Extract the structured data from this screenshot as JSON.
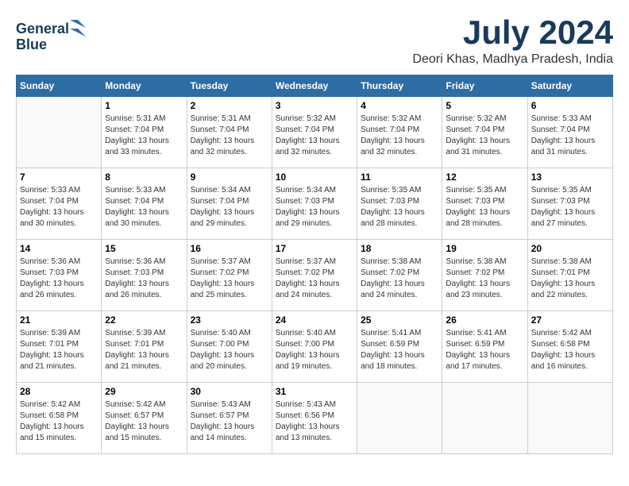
{
  "header": {
    "logo_line1": "General",
    "logo_line2": "Blue",
    "month_year": "July 2024",
    "location": "Deori Khas, Madhya Pradesh, India"
  },
  "days_of_week": [
    "Sunday",
    "Monday",
    "Tuesday",
    "Wednesday",
    "Thursday",
    "Friday",
    "Saturday"
  ],
  "weeks": [
    [
      {
        "day": "",
        "info": ""
      },
      {
        "day": "1",
        "info": "Sunrise: 5:31 AM\nSunset: 7:04 PM\nDaylight: 13 hours\nand 33 minutes."
      },
      {
        "day": "2",
        "info": "Sunrise: 5:31 AM\nSunset: 7:04 PM\nDaylight: 13 hours\nand 32 minutes."
      },
      {
        "day": "3",
        "info": "Sunrise: 5:32 AM\nSunset: 7:04 PM\nDaylight: 13 hours\nand 32 minutes."
      },
      {
        "day": "4",
        "info": "Sunrise: 5:32 AM\nSunset: 7:04 PM\nDaylight: 13 hours\nand 32 minutes."
      },
      {
        "day": "5",
        "info": "Sunrise: 5:32 AM\nSunset: 7:04 PM\nDaylight: 13 hours\nand 31 minutes."
      },
      {
        "day": "6",
        "info": "Sunrise: 5:33 AM\nSunset: 7:04 PM\nDaylight: 13 hours\nand 31 minutes."
      }
    ],
    [
      {
        "day": "7",
        "info": "Sunrise: 5:33 AM\nSunset: 7:04 PM\nDaylight: 13 hours\nand 30 minutes."
      },
      {
        "day": "8",
        "info": "Sunrise: 5:33 AM\nSunset: 7:04 PM\nDaylight: 13 hours\nand 30 minutes."
      },
      {
        "day": "9",
        "info": "Sunrise: 5:34 AM\nSunset: 7:04 PM\nDaylight: 13 hours\nand 29 minutes."
      },
      {
        "day": "10",
        "info": "Sunrise: 5:34 AM\nSunset: 7:03 PM\nDaylight: 13 hours\nand 29 minutes."
      },
      {
        "day": "11",
        "info": "Sunrise: 5:35 AM\nSunset: 7:03 PM\nDaylight: 13 hours\nand 28 minutes."
      },
      {
        "day": "12",
        "info": "Sunrise: 5:35 AM\nSunset: 7:03 PM\nDaylight: 13 hours\nand 28 minutes."
      },
      {
        "day": "13",
        "info": "Sunrise: 5:35 AM\nSunset: 7:03 PM\nDaylight: 13 hours\nand 27 minutes."
      }
    ],
    [
      {
        "day": "14",
        "info": "Sunrise: 5:36 AM\nSunset: 7:03 PM\nDaylight: 13 hours\nand 26 minutes."
      },
      {
        "day": "15",
        "info": "Sunrise: 5:36 AM\nSunset: 7:03 PM\nDaylight: 13 hours\nand 26 minutes."
      },
      {
        "day": "16",
        "info": "Sunrise: 5:37 AM\nSunset: 7:02 PM\nDaylight: 13 hours\nand 25 minutes."
      },
      {
        "day": "17",
        "info": "Sunrise: 5:37 AM\nSunset: 7:02 PM\nDaylight: 13 hours\nand 24 minutes."
      },
      {
        "day": "18",
        "info": "Sunrise: 5:38 AM\nSunset: 7:02 PM\nDaylight: 13 hours\nand 24 minutes."
      },
      {
        "day": "19",
        "info": "Sunrise: 5:38 AM\nSunset: 7:02 PM\nDaylight: 13 hours\nand 23 minutes."
      },
      {
        "day": "20",
        "info": "Sunrise: 5:38 AM\nSunset: 7:01 PM\nDaylight: 13 hours\nand 22 minutes."
      }
    ],
    [
      {
        "day": "21",
        "info": "Sunrise: 5:39 AM\nSunset: 7:01 PM\nDaylight: 13 hours\nand 21 minutes."
      },
      {
        "day": "22",
        "info": "Sunrise: 5:39 AM\nSunset: 7:01 PM\nDaylight: 13 hours\nand 21 minutes."
      },
      {
        "day": "23",
        "info": "Sunrise: 5:40 AM\nSunset: 7:00 PM\nDaylight: 13 hours\nand 20 minutes."
      },
      {
        "day": "24",
        "info": "Sunrise: 5:40 AM\nSunset: 7:00 PM\nDaylight: 13 hours\nand 19 minutes."
      },
      {
        "day": "25",
        "info": "Sunrise: 5:41 AM\nSunset: 6:59 PM\nDaylight: 13 hours\nand 18 minutes."
      },
      {
        "day": "26",
        "info": "Sunrise: 5:41 AM\nSunset: 6:59 PM\nDaylight: 13 hours\nand 17 minutes."
      },
      {
        "day": "27",
        "info": "Sunrise: 5:42 AM\nSunset: 6:58 PM\nDaylight: 13 hours\nand 16 minutes."
      }
    ],
    [
      {
        "day": "28",
        "info": "Sunrise: 5:42 AM\nSunset: 6:58 PM\nDaylight: 13 hours\nand 15 minutes."
      },
      {
        "day": "29",
        "info": "Sunrise: 5:42 AM\nSunset: 6:57 PM\nDaylight: 13 hours\nand 15 minutes."
      },
      {
        "day": "30",
        "info": "Sunrise: 5:43 AM\nSunset: 6:57 PM\nDaylight: 13 hours\nand 14 minutes."
      },
      {
        "day": "31",
        "info": "Sunrise: 5:43 AM\nSunset: 6:56 PM\nDaylight: 13 hours\nand 13 minutes."
      },
      {
        "day": "",
        "info": ""
      },
      {
        "day": "",
        "info": ""
      },
      {
        "day": "",
        "info": ""
      }
    ]
  ]
}
